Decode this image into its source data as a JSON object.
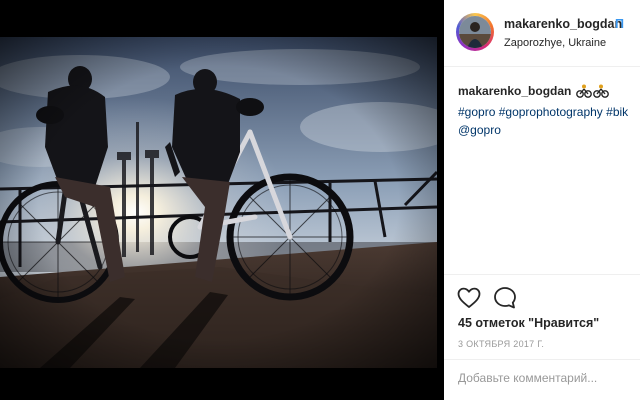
{
  "post": {
    "username": "makarenko_bogdan",
    "follow_label": "П",
    "location": "Zaporozhye, Ukraine"
  },
  "caption": {
    "username": "makarenko_bogdan",
    "emoji_icon": "bicyclist-emoji-icon",
    "tags_line1": [
      "#gopro",
      "#goprophotography",
      "#bik"
    ],
    "mention": "@gopro"
  },
  "actions": {
    "like_icon": "heart-outline-icon",
    "comment_icon": "speech-bubble-icon",
    "likes_text": "45 отметок \"Нравится\"",
    "date": "3 ОКТЯБРЯ 2017 Г.",
    "comment_placeholder": "Добавьте комментарий..."
  },
  "colors": {
    "link": "#003569",
    "follow": "#3897f0",
    "text": "#262626",
    "muted": "#999999"
  }
}
